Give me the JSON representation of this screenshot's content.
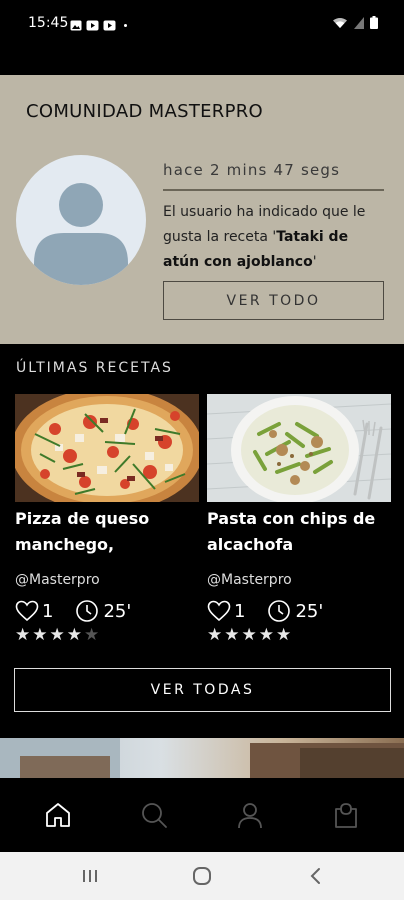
{
  "status_bar": {
    "time": "15:45",
    "icons_left": [
      "gallery-icon",
      "youtube-icon",
      "youtube-icon",
      "dot"
    ],
    "icons_right": [
      "wifi-icon",
      "signal-icon",
      "battery-icon"
    ]
  },
  "community": {
    "title": "COMUNIDAD MASTERPRO",
    "timestamp": "hace 2 mins 47 segs",
    "activity_prefix": "El usuario ha indicado que le gusta la receta '",
    "activity_recipe": "Tataki de atún con ajoblanco",
    "activity_suffix": "'",
    "button_label": "VER TODO"
  },
  "recipes": {
    "heading": "ÚLTIMAS RECETAS",
    "items": [
      {
        "title": "Pizza de queso manchego, partisano y",
        "author": "@Masterpro",
        "likes": "1",
        "time": "25'",
        "rating": 4,
        "rating_max": 5,
        "image": "pizza"
      },
      {
        "title": "Pasta con chips de alcachofa",
        "author": "@Masterpro",
        "likes": "1",
        "time": "25'",
        "rating": 5,
        "rating_max": 5,
        "image": "pasta"
      }
    ],
    "button_label": "VER TODAS"
  },
  "bottom_nav": {
    "items": [
      {
        "name": "home",
        "icon": "home-icon",
        "active": true
      },
      {
        "name": "search",
        "icon": "search-icon",
        "active": false
      },
      {
        "name": "profile",
        "icon": "user-icon",
        "active": false
      },
      {
        "name": "cart",
        "icon": "shopping-bag-icon",
        "active": false
      }
    ]
  },
  "android_nav": {
    "buttons": [
      "recents-icon",
      "home-circle-icon",
      "back-icon"
    ]
  },
  "colors": {
    "background": "#000000",
    "community_bg": "#bcb6a6",
    "avatar_bg": "#e3eaf1",
    "avatar_fg": "#8fa6b6",
    "nav_active": "#ffffff",
    "nav_inactive": "#555555"
  }
}
